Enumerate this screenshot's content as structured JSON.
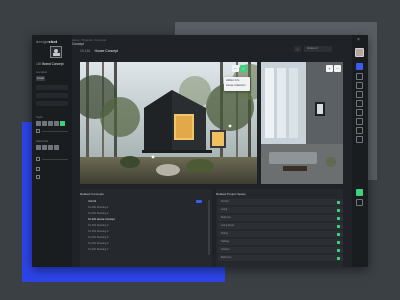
{
  "app": {
    "logo_light": "design",
    "logo_bold": "shot",
    "close_glyph": "×"
  },
  "sidebar": {
    "project_number": "185",
    "project_name": "Brand Concept",
    "section1_label": "Location",
    "chip_label": "Forest",
    "section2_label": "Style",
    "section3_label": "Materials"
  },
  "header": {
    "breadcrumb": "Home / Projects / Concepts",
    "section_title": "Concept",
    "project_number": "19-181",
    "project_title": "House Concept",
    "plus_glyph": "+",
    "select_value": "Version 2"
  },
  "image_menu": {
    "items": [
      "Hidden Info",
      "House Collection"
    ]
  },
  "toolbar_icons": {
    "tick": "✓",
    "more": "⋯"
  },
  "related_concepts": {
    "title": "Related Concepts",
    "rows": [
      "Unit 01",
      "01-181 Drawing 1",
      "01-181 Drawing 2",
      "01-181 House Concept",
      "01-181 Drawing 3",
      "01-181 Drawing 4",
      "01-181 Drawing 5",
      "01-181 Drawing 6",
      "01-181 Drawing 7"
    ]
  },
  "related_spaces": {
    "title": "Related Project Space",
    "rows": [
      "Kitchen",
      "Living",
      "Bedroom",
      "Living Room",
      "Dining",
      "Hallway",
      "Outdoor",
      "Bathroom"
    ]
  },
  "colors": {
    "accent_blue": "#3d5af1",
    "accent_green": "#3ed27e",
    "bg_dark": "#1f2226"
  }
}
